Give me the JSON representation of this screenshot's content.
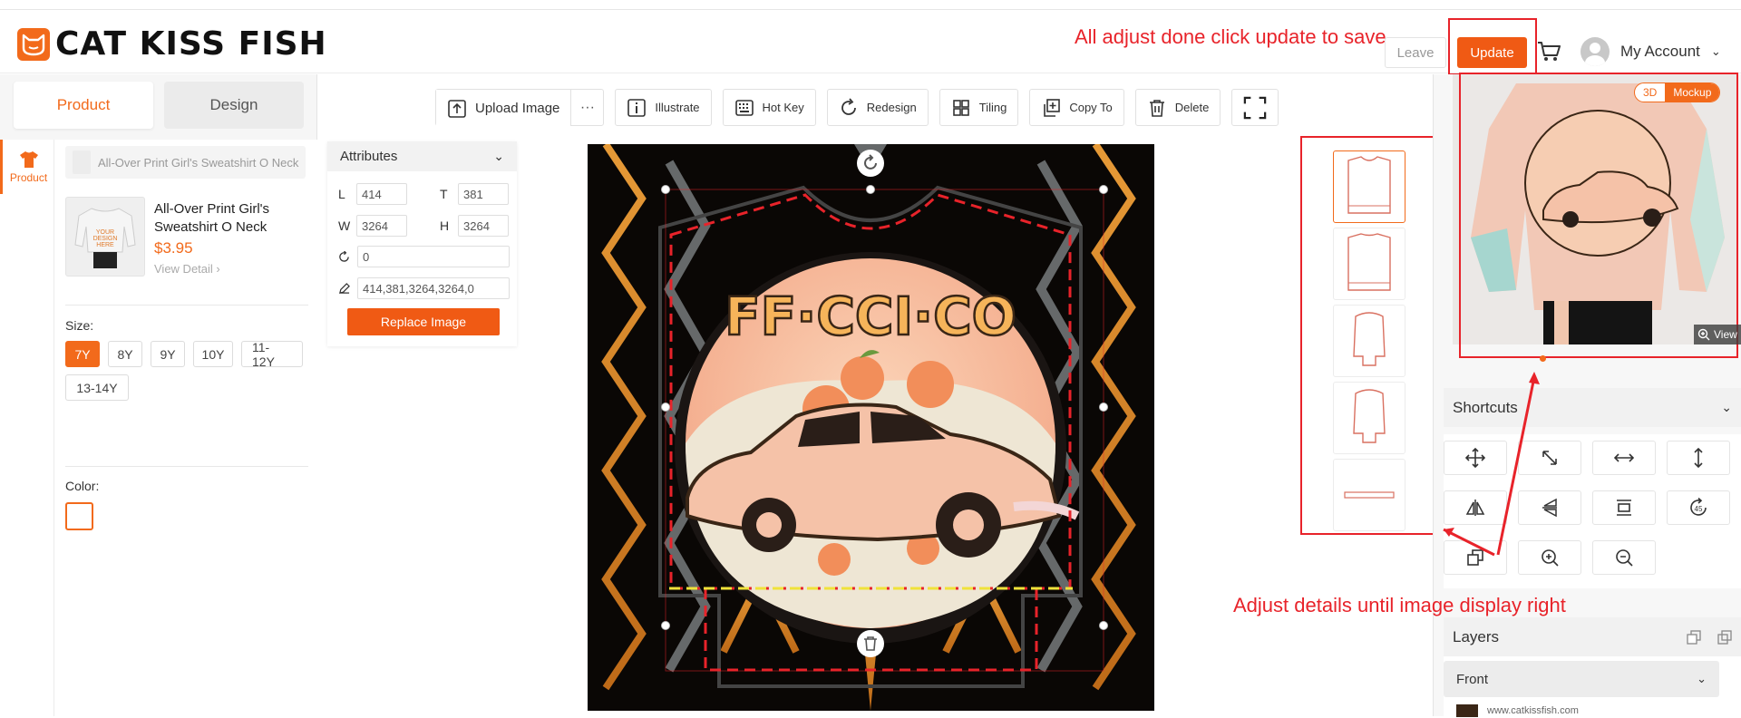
{
  "brand": {
    "name": "CAT KISS FISH"
  },
  "header": {
    "leave_label": "Leave",
    "update_label": "Update",
    "account_label": "My Account"
  },
  "annotations": {
    "update_hint": "All adjust done click update to save",
    "adjust_hint": "Adjust details until image display right"
  },
  "left": {
    "tabs": [
      "Product",
      "Design"
    ],
    "nav_item": "Product",
    "product_select": "All-Over Print Girl's Sweatshirt O Neck",
    "product_name": "All-Over Print Girl's Sweatshirt O Neck",
    "price": "$3.95",
    "view_detail": "View Detail",
    "size_label": "Size:",
    "sizes": [
      "7Y",
      "8Y",
      "9Y",
      "10Y",
      "11-12Y",
      "13-14Y"
    ],
    "selected_size": "7Y",
    "color_label": "Color:"
  },
  "toolbar": {
    "upload": "Upload Image",
    "more": "···",
    "illustrate": "Illustrate",
    "hotkey": "Hot Key",
    "redesign": "Redesign",
    "tiling": "Tiling",
    "copy_to": "Copy To",
    "delete": "Delete"
  },
  "attributes": {
    "title": "Attributes",
    "L_label": "L",
    "L": "414",
    "T_label": "T",
    "T": "381",
    "W_label": "W",
    "W": "3264",
    "H_label": "H",
    "H": "3264",
    "rotation": "0",
    "combined": "414,381,3264,3264,0",
    "replace_label": "Replace Image"
  },
  "canvas": {
    "artwork_text": "FF·CCI·CO"
  },
  "mockup": {
    "tabs": [
      "3D",
      "Mockup"
    ],
    "view_label": "View"
  },
  "shortcuts": {
    "title": "Shortcuts"
  },
  "layers": {
    "title": "Layers",
    "group": "Front",
    "layer_name": "www.catkissfish.com"
  },
  "colors": {
    "accent": "#f26a1b",
    "annotation": "#e8232a"
  }
}
